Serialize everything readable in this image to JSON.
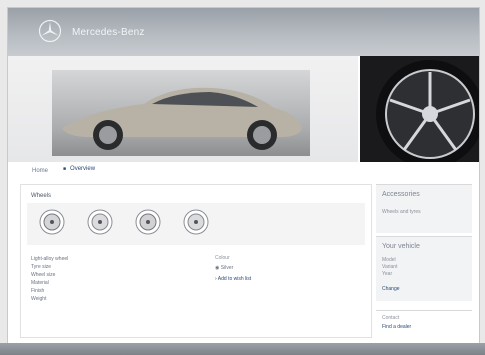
{
  "header": {
    "brand": "Mercedes-Benz"
  },
  "breadcrumb": {
    "home": "Home",
    "link": "Overview"
  },
  "main": {
    "title": "Wheels",
    "info_lines": [
      "Light-alloy wheel",
      "Tyre size",
      "Wheel size",
      "Material",
      "Finish",
      "Weight"
    ],
    "mid_label": "Colour",
    "mid_radio": "Silver",
    "mid_link": "Add to wish list"
  },
  "sidebar": {
    "box1_title": "Accessories",
    "box1_text": "Wheels and tyres",
    "box2_title": "Your vehicle",
    "box2_lines": [
      "Model",
      "Variant",
      "Year"
    ],
    "box2_link": "Change",
    "box3_text": "Contact",
    "box3_link": "Find a dealer"
  },
  "colors": {
    "header": "#a6abb1",
    "link": "#2c4a78",
    "footer": "#8a8f95"
  }
}
